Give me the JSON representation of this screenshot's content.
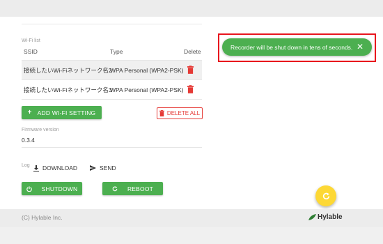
{
  "wifi": {
    "section_label": "Wi-Fi list",
    "columns": {
      "ssid": "SSID",
      "type": "Type",
      "delete": "Delete"
    },
    "rows": [
      {
        "ssid": "接続したいWi-Fiネットワーク名2",
        "type": "WPA Personal (WPA2-PSK)"
      },
      {
        "ssid": "接続したいWi-Fiネットワーク名3",
        "type": "WPA Personal (WPA2-PSK)"
      }
    ],
    "add_label": "ADD WI-FI SETTING",
    "delete_all_label": "DELETE ALL"
  },
  "firmware": {
    "label": "Firmware version",
    "value": "0.3.4"
  },
  "log": {
    "label": "Log",
    "download_label": "DOWNLOAD",
    "send_label": "SEND"
  },
  "power": {
    "shutdown_label": "SHUTDOWN",
    "reboot_label": "REBOOT"
  },
  "toast": {
    "message": "Recorder will be shut down in tens of seconds."
  },
  "footer": {
    "copyright": "(C) Hylable Inc.",
    "brand": "Hylable"
  },
  "colors": {
    "accent_green": "#4caf50",
    "danger_red": "#e53935",
    "fab_yellow": "#fdd835",
    "highlight_red": "#e8141d"
  }
}
